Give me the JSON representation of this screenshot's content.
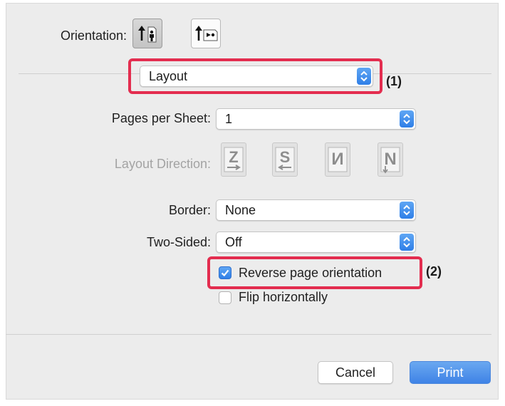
{
  "orientation": {
    "label": "Orientation:",
    "portrait_icon": "portrait-orientation-icon",
    "landscape_icon": "landscape-orientation-icon",
    "selected": "portrait"
  },
  "section_popup": {
    "value": "Layout",
    "callout": "(1)"
  },
  "pages_per_sheet": {
    "label": "Pages per Sheet:",
    "value": "1"
  },
  "layout_direction": {
    "label": "Layout Direction:",
    "options": [
      "z-direction-icon",
      "reverse-s-direction-icon",
      "reverse-n-direction-icon",
      "n-direction-icon"
    ]
  },
  "border": {
    "label": "Border:",
    "value": "None"
  },
  "two_sided": {
    "label": "Two-Sided:",
    "value": "Off"
  },
  "reverse_orientation": {
    "label": "Reverse page orientation",
    "checked": true,
    "callout": "(2)"
  },
  "flip_horizontally": {
    "label": "Flip horizontally",
    "checked": false
  },
  "buttons": {
    "cancel": "Cancel",
    "print": "Print"
  },
  "colors": {
    "accent": "#3f83e6",
    "highlight": "#e32d4f",
    "panel": "#ececec"
  }
}
